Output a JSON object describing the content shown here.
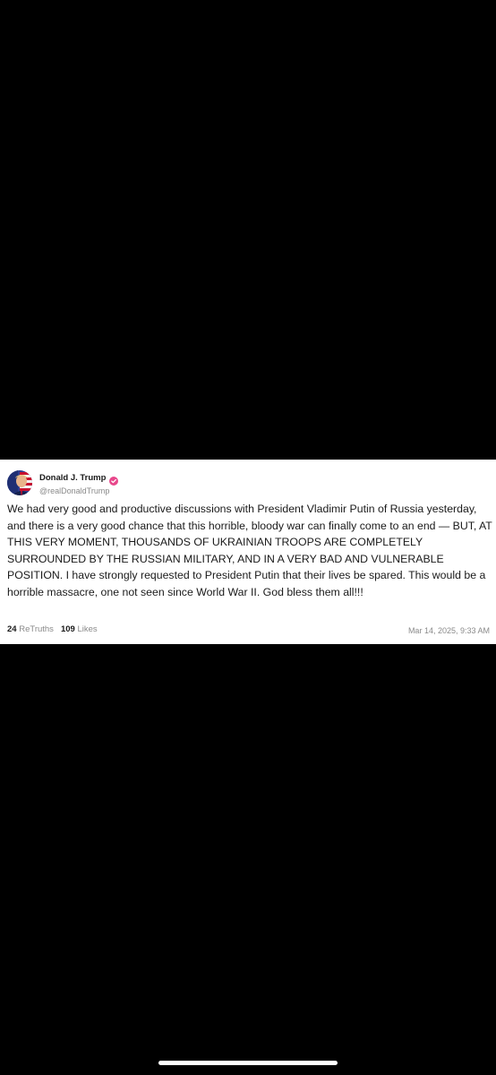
{
  "post": {
    "author": {
      "display_name": "Donald J. Trump",
      "handle": "@realDonaldTrump",
      "verified": true,
      "verified_color": "#e8478b"
    },
    "text": "We had very good and productive discussions with President Vladimir Putin of Russia yesterday, and there is a very good chance that this horrible, bloody war can finally come to an end — BUT, AT THIS VERY MOMENT, THOUSANDS OF UKRAINIAN TROOPS ARE COMPLETELY SURROUNDED BY THE RUSSIAN MILITARY, AND IN A VERY BAD AND VULNERABLE POSITION. I have strongly requested to President Putin that their lives be spared. This would be a horrible massacre, one not seen since World War II. God bless them all!!!",
    "stats": {
      "retruths_count": "24",
      "retruths_label": "ReTruths",
      "likes_count": "109",
      "likes_label": "Likes"
    },
    "timestamp": "Mar 14, 2025, 9:33 AM"
  },
  "icons": {
    "avatar": "avatar-image",
    "verified": "verified-badge-icon"
  },
  "colors": {
    "background": "#000000",
    "card": "#ffffff",
    "text_primary": "#1a1a1a",
    "text_secondary": "#8a8a8a"
  }
}
